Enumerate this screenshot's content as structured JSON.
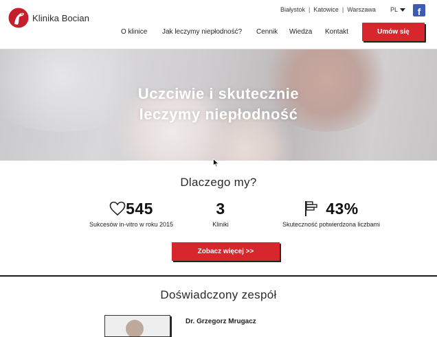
{
  "brand": {
    "name": "Klinika Bocian",
    "logo_color": "#c41f2d"
  },
  "header": {
    "cities": [
      "Białystok",
      "Katowice",
      "Warszawa"
    ],
    "language": "PL",
    "facebook_icon": "f",
    "nav": [
      "O klinice",
      "Jak leczymy niepłodność?",
      "Cennik",
      "Wiedza",
      "Kontakt"
    ],
    "cta_label": "Umów się"
  },
  "hero": {
    "title_line1": "Uczciwie i skutecznie",
    "title_line2": "leczymy niepłodność"
  },
  "why": {
    "title": "Dlaczego my?",
    "stats": [
      {
        "icon": "heart-icon",
        "value": "545",
        "label": "Sukcesów in-vitro w roku 2015"
      },
      {
        "icon": "",
        "value": "3",
        "label": "Kliniki"
      },
      {
        "icon": "flag-icon",
        "value": "43%",
        "label": "Skuteczność potwierdzona liczbami"
      }
    ],
    "button_label": "Zobacz więcej >>"
  },
  "team": {
    "title": "Doświadczony zespół",
    "doctor_name": "Dr. Grzegorz Mrugacz"
  },
  "colors": {
    "accent": "#d7262e",
    "facebook": "#3b5bb5",
    "text": "#222222"
  }
}
